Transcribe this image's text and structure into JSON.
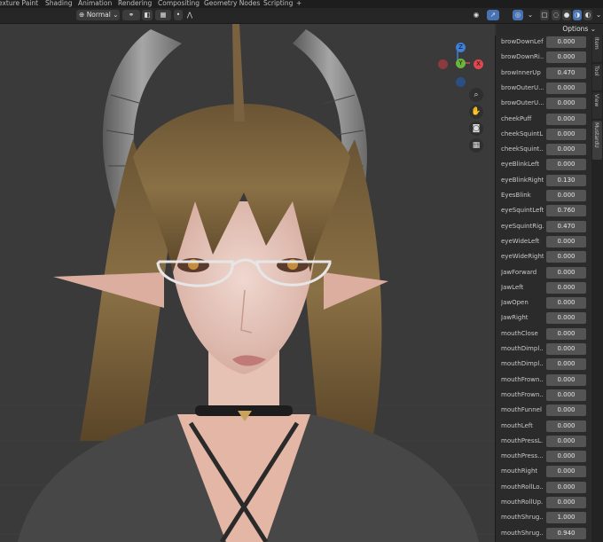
{
  "workspace_tabs": [
    "exture Paint",
    "Shading",
    "Animation",
    "Rendering",
    "Compositing",
    "Geometry Nodes",
    "Scripting",
    "+"
  ],
  "toolbar": {
    "transform_orientation": "Normal"
  },
  "options_label": "Options",
  "side_tabs": [
    "Item",
    "Tool",
    "View",
    "MustardU"
  ],
  "gizmo": {
    "z": "Z",
    "y": "Y",
    "x": "X"
  },
  "shape_keys": [
    {
      "name": "browDownLef",
      "value": "0.000"
    },
    {
      "name": "browDownRi...",
      "value": "0.000"
    },
    {
      "name": "browInnerUp",
      "value": "0.470"
    },
    {
      "name": "browOuterU...",
      "value": "0.000"
    },
    {
      "name": "browOuterU...",
      "value": "0.000"
    },
    {
      "name": "cheekPuff",
      "value": "0.000"
    },
    {
      "name": "cheekSquintL",
      "value": "0.000"
    },
    {
      "name": "cheekSquint...",
      "value": "0.000"
    },
    {
      "name": "eyeBlinkLeft",
      "value": "0.000"
    },
    {
      "name": "eyeBlinkRight",
      "value": "0.130"
    },
    {
      "name": "EyesBlink",
      "value": "0.000"
    },
    {
      "name": "eyeSquintLeft",
      "value": "0.760"
    },
    {
      "name": "eyeSquintRig...",
      "value": "0.470"
    },
    {
      "name": "eyeWideLeft",
      "value": "0.000"
    },
    {
      "name": "eyeWideRight",
      "value": "0.000"
    },
    {
      "name": "JawForward",
      "value": "0.000"
    },
    {
      "name": "JawLeft",
      "value": "0.000"
    },
    {
      "name": "JawOpen",
      "value": "0.000"
    },
    {
      "name": "JawRight",
      "value": "0.000"
    },
    {
      "name": "mouthClose",
      "value": "0.000"
    },
    {
      "name": "mouthDimpl...",
      "value": "0.000"
    },
    {
      "name": "mouthDimpl...",
      "value": "0.000"
    },
    {
      "name": "mouthFrown...",
      "value": "0.000"
    },
    {
      "name": "mouthFrown...",
      "value": "0.000"
    },
    {
      "name": "mouthFunnel",
      "value": "0.000"
    },
    {
      "name": "mouthLeft",
      "value": "0.000"
    },
    {
      "name": "mouthPressL...",
      "value": "0.000"
    },
    {
      "name": "mouthPress...",
      "value": "0.000"
    },
    {
      "name": "mouthRight",
      "value": "0.000"
    },
    {
      "name": "mouthRollLo...",
      "value": "0.000"
    },
    {
      "name": "mouthRollUp...",
      "value": "0.000"
    },
    {
      "name": "mouthShrug...",
      "value": "1.000"
    },
    {
      "name": "mouthShrug...",
      "value": "0.940"
    }
  ],
  "colors": {
    "accent": "#4772b3",
    "gizmo_x": "#e0464e",
    "gizmo_y": "#6ab638",
    "gizmo_z": "#3d7fd9"
  }
}
